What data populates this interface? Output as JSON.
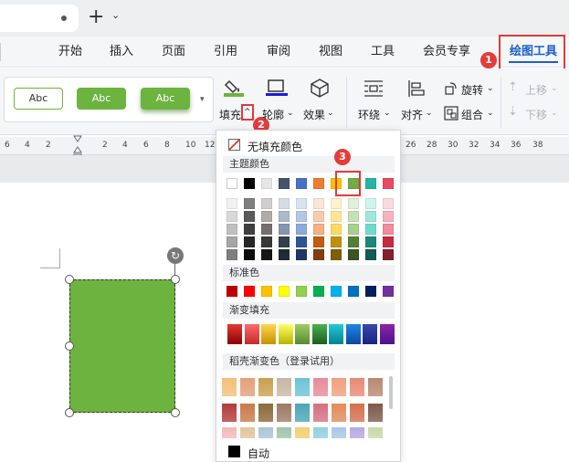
{
  "titlebar": {
    "new_tab_symbol": "+",
    "chevron": "⌄"
  },
  "menubar": {
    "items": [
      "开始",
      "插入",
      "页面",
      "引用",
      "审阅",
      "视图",
      "工具",
      "会员专享",
      "绘图工具"
    ],
    "active": "绘图工具"
  },
  "toolbar": {
    "style_buttons": [
      "Abc",
      "Abc",
      "Abc"
    ],
    "fill_label": "填充",
    "outline_label": "轮廓",
    "effect_label": "效果",
    "wrap_label": "环绕",
    "align_label": "对齐",
    "rotate_label": "旋转",
    "group_label": "组合",
    "up_label": "上移",
    "down_label": "下移"
  },
  "ruler": {
    "numbers": [
      "6",
      "4",
      "2",
      "2",
      "4",
      "6",
      "8",
      "10",
      "12",
      "14",
      "16",
      "26",
      "28",
      "30",
      "32",
      "34",
      "36",
      "38"
    ]
  },
  "dropdown": {
    "no_fill_label": "无填充颜色",
    "theme_colors_label": "主题颜色",
    "standard_colors_label": "标准色",
    "gradient_fill_label": "渐变填充",
    "docer_gradient_label": "稻壳渐变色（登录试用）",
    "auto_label": "自动",
    "theme_top_row": [
      "#ffffff",
      "#000000",
      "#e7e6e6",
      "#44546a",
      "#4472c4",
      "#ed7d31",
      "#ffc000",
      "#70ad47",
      "#26b5a5",
      "#e84c5e"
    ],
    "theme_shades": [
      [
        "#f2f2f2",
        "#7f7f7f",
        "#d0cece",
        "#d6dce4",
        "#d9e2f3",
        "#fbe5d5",
        "#fff2cc",
        "#e2efd9",
        "#cff3ef",
        "#fbd9de"
      ],
      [
        "#d8d8d8",
        "#595959",
        "#aeabab",
        "#adb9ca",
        "#b4c6e7",
        "#f7cbac",
        "#fee599",
        "#c5e0b3",
        "#a1e6de",
        "#f6b3bd"
      ],
      [
        "#bfbfbf",
        "#3f3f3f",
        "#757070",
        "#8496b0",
        "#8eaadb",
        "#f4b183",
        "#ffd965",
        "#a8d08d",
        "#72dacd",
        "#f18c9c"
      ],
      [
        "#a5a5a5",
        "#262626",
        "#3a3838",
        "#323f4f",
        "#2f5496",
        "#c55a11",
        "#bf9000",
        "#538135",
        "#1c877b",
        "#c42b41"
      ],
      [
        "#7f7f7f",
        "#0c0c0c",
        "#171616",
        "#222a35",
        "#1f3763",
        "#833c0b",
        "#7f6000",
        "#375623",
        "#125a52",
        "#83202c"
      ]
    ],
    "standard_colors": [
      "#c00000",
      "#ff0000",
      "#ffc000",
      "#ffff00",
      "#92d050",
      "#00b050",
      "#00b0f0",
      "#0070c0",
      "#002060",
      "#7030a0"
    ],
    "gradient_colors": [
      [
        "#e53935",
        "#8b0000"
      ],
      [
        "#ff6b6b",
        "#c62828"
      ],
      [
        "#ffd54f",
        "#c79100"
      ],
      [
        "#ffff66",
        "#b5b500"
      ],
      [
        "#9ccc65",
        "#558b2f"
      ],
      [
        "#4caf50",
        "#1b5e20"
      ],
      [
        "#26c6da",
        "#00838f"
      ],
      [
        "#1e88e5",
        "#0d47a1"
      ],
      [
        "#3949ab",
        "#1a237e"
      ],
      [
        "#8e24aa",
        "#4a148c"
      ]
    ],
    "docer_rows": [
      [
        "#f3c07a",
        "#e3a078",
        "#c9a04f",
        "#c8b6a6",
        "#6bc3d8",
        "#e68b9a",
        "#f0a07e",
        "#e88a76",
        "#b68a70"
      ],
      [
        "#b33b3b",
        "#c87a4a",
        "#8a6a3a",
        "#9c7a66",
        "#4aa6b8",
        "#d46f80",
        "#e38a5a",
        "#d4704c",
        "#7e5a48"
      ],
      [
        "#f4b8b8",
        "#e0c59c",
        "#a9c4d8",
        "#9fc3a8",
        "#f0d070",
        "#8fd0e0",
        "#a7c7e7",
        "#b7a7e0",
        "#c8d8a8"
      ]
    ],
    "selected_color": "#70ad47"
  },
  "annotations": [
    "1",
    "2",
    "3"
  ],
  "shape": {
    "fill_color": "#6cb33f"
  }
}
